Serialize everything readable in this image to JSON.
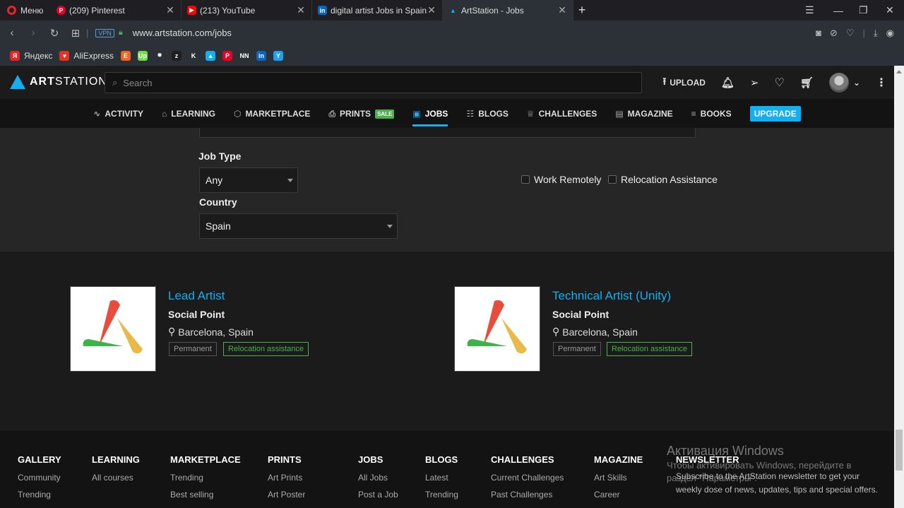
{
  "browser": {
    "menu_label": "Меню",
    "tabs": [
      {
        "title": "(209) Pinterest",
        "favicon": "pinterest-icon",
        "color": "#e60023"
      },
      {
        "title": "(213) YouTube",
        "favicon": "youtube-icon",
        "color": "#ff0000"
      },
      {
        "title": "digital artist Jobs in Spain |",
        "favicon": "linkedin-icon",
        "color": "#0a66c2"
      },
      {
        "title": "ArtStation - Jobs",
        "favicon": "artstation-icon",
        "color": "#13aff0"
      }
    ],
    "url": "www.artstation.com/jobs",
    "vpn_label": "VPN",
    "bookmarks": [
      {
        "label": "Яндекс",
        "icon": "yandex-icon",
        "color": "#e0262a",
        "glyph": "Я"
      },
      {
        "label": "AliExpress",
        "icon": "aliexpress-icon",
        "color": "#e43225",
        "glyph": "♥"
      },
      {
        "label": "",
        "icon": "etsy-icon",
        "color": "#f1641e",
        "glyph": "E"
      },
      {
        "label": "",
        "icon": "upwork-icon",
        "color": "#6fda44",
        "glyph": "Up"
      },
      {
        "label": "",
        "icon": "bug-icon",
        "color": "#2c3137",
        "glyph": "✹"
      },
      {
        "label": "",
        "icon": "z-icon",
        "color": "#1f1f23",
        "glyph": "z"
      },
      {
        "label": "",
        "icon": "k-icon",
        "color": "#2c3137",
        "glyph": "K"
      },
      {
        "label": "",
        "icon": "artstation-bm-icon",
        "color": "#13aff0",
        "glyph": "▲"
      },
      {
        "label": "",
        "icon": "pinterest-bm-icon",
        "color": "#e60023",
        "glyph": "P"
      },
      {
        "label": "",
        "icon": "nn-icon",
        "color": "#2c3137",
        "glyph": "NN"
      },
      {
        "label": "",
        "icon": "linkedin-bm-icon",
        "color": "#0a66c2",
        "glyph": "in"
      },
      {
        "label": "",
        "icon": "y-icon",
        "color": "#1da1f2",
        "glyph": "Y"
      }
    ]
  },
  "header": {
    "logo_bold": "ART",
    "logo_rest": "STATION",
    "search_placeholder": "Search",
    "upload_label": "UPLOAD"
  },
  "nav": [
    {
      "label": "ACTIVITY",
      "icon": "activity-icon",
      "glyph": "∿"
    },
    {
      "label": "LEARNING",
      "icon": "learning-icon",
      "glyph": "⌂"
    },
    {
      "label": "MARKETPLACE",
      "icon": "marketplace-icon",
      "glyph": "⬡"
    },
    {
      "label": "PRINTS",
      "icon": "prints-icon",
      "glyph": "⎙"
    },
    {
      "label": "JOBS",
      "icon": "jobs-icon",
      "glyph": "▣"
    },
    {
      "label": "BLOGS",
      "icon": "blogs-icon",
      "glyph": "☷"
    },
    {
      "label": "CHALLENGES",
      "icon": "challenges-icon",
      "glyph": "♕"
    },
    {
      "label": "MAGAZINE",
      "icon": "magazine-icon",
      "glyph": "▤"
    },
    {
      "label": "BOOKS",
      "icon": "books-icon",
      "glyph": "≡"
    }
  ],
  "nav_sale": "SALE",
  "nav_upgrade": "UPGRADE",
  "filters": {
    "job_type_label": "Job Type",
    "job_type_value": "Any",
    "country_label": "Country",
    "country_value": "Spain",
    "remote_label": "Work Remotely",
    "relocation_label": "Relocation Assistance"
  },
  "jobs": [
    {
      "title": "Lead Artist",
      "company": "Social Point",
      "location": "Barcelona, Spain",
      "tag1": "Permanent",
      "tag2": "Relocation assistance"
    },
    {
      "title": "Technical Artist (Unity)",
      "company": "Social Point",
      "location": "Barcelona, Spain",
      "tag1": "Permanent",
      "tag2": "Relocation assistance"
    }
  ],
  "footer": {
    "columns": [
      {
        "head": "GALLERY",
        "links": [
          "Community",
          "Trending"
        ]
      },
      {
        "head": "LEARNING",
        "links": [
          "All courses"
        ]
      },
      {
        "head": "MARKETPLACE",
        "links": [
          "Trending",
          "Best selling"
        ]
      },
      {
        "head": "PRINTS",
        "links": [
          "Art Prints",
          "Art Poster"
        ]
      },
      {
        "head": "JOBS",
        "links": [
          "All Jobs",
          "Post a Job"
        ]
      },
      {
        "head": "BLOGS",
        "links": [
          "Latest",
          "Trending"
        ]
      },
      {
        "head": "CHALLENGES",
        "links": [
          "Current Challenges",
          "Past Challenges"
        ]
      },
      {
        "head": "MAGAZINE",
        "links": [
          "Art Skills",
          "Career"
        ]
      }
    ],
    "newsletter_head": "NEWSLETTER",
    "newsletter_text": "Subscribe to the ArtStation newsletter to get your weekly dose of news, updates, tips and special offers.",
    "watermark_title": "Активация Windows",
    "watermark_sub": "Чтобы активировать Windows, перейдите в раздел \"Параметры\"."
  },
  "colors": {
    "accent": "#13aff0",
    "green": "#4caf50"
  }
}
